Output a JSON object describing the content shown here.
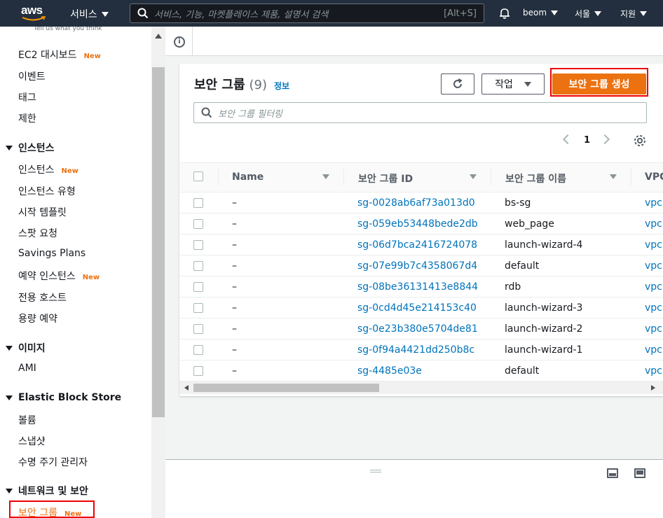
{
  "topbar": {
    "logo": "aws",
    "services_label": "서비스",
    "search_placeholder": "서비스, 기능, 마켓플레이스 제품, 설명서 검색",
    "search_shortcut": "[Alt+S]",
    "user": "beom",
    "region": "서울",
    "support": "지원"
  },
  "sidebar": {
    "feedback": "Tell us what you think",
    "new_label": "New",
    "items": [
      {
        "label": "EC2 대시보드",
        "new": true
      },
      {
        "label": "이벤트"
      },
      {
        "label": "태그"
      },
      {
        "label": "제한"
      }
    ],
    "sections": [
      {
        "title": "인스턴스",
        "items": [
          "인스턴스",
          "인스턴스 유형",
          "시작 템플릿",
          "스팟 요청",
          "Savings Plans",
          "예약 인스턴스",
          "전용 호스트",
          "용량 예약"
        ]
      },
      {
        "title": "이미지",
        "items": [
          "AMI"
        ]
      },
      {
        "title": "Elastic Block Store",
        "items": [
          "볼륨",
          "스냅샷",
          "수명 주기 관리자"
        ]
      },
      {
        "title": "네트워크 및 보안",
        "items": [
          "보안 그룹"
        ]
      }
    ]
  },
  "main": {
    "title": "보안 그룹",
    "count": "(9)",
    "info_link": "정보",
    "actions_label": "작업",
    "create_label": "보안 그룹 생성",
    "filter_placeholder": "보안 그룹 필터링",
    "page": "1",
    "columns": [
      "Name",
      "보안 그룹 ID",
      "보안 그룹 이름",
      "VPC"
    ],
    "rows": [
      {
        "name": "–",
        "id": "sg-0028ab6af73a013d0",
        "group_name": "bs-sg",
        "vpc": "vpc"
      },
      {
        "name": "–",
        "id": "sg-059eb53448bede2db",
        "group_name": "web_page",
        "vpc": "vpc"
      },
      {
        "name": "–",
        "id": "sg-06d7bca2416724078",
        "group_name": "launch-wizard-4",
        "vpc": "vpc"
      },
      {
        "name": "–",
        "id": "sg-07e99b7c4358067d4",
        "group_name": "default",
        "vpc": "vpc"
      },
      {
        "name": "–",
        "id": "sg-08be36131413e8844",
        "group_name": "rdb",
        "vpc": "vpc"
      },
      {
        "name": "–",
        "id": "sg-0cd4d45e214153c40",
        "group_name": "launch-wizard-3",
        "vpc": "vpc"
      },
      {
        "name": "–",
        "id": "sg-0e23b380e5704de81",
        "group_name": "launch-wizard-2",
        "vpc": "vpc"
      },
      {
        "name": "–",
        "id": "sg-0f94a4421dd250b8c",
        "group_name": "launch-wizard-1",
        "vpc": "vpc"
      },
      {
        "name": "–",
        "id": "sg-4485e03e",
        "group_name": "default",
        "vpc": "vpc"
      }
    ]
  },
  "colors": {
    "topbar": "#232f3e",
    "primary": "#ec7211",
    "link": "#0073bb",
    "highlight": "#e00000"
  }
}
